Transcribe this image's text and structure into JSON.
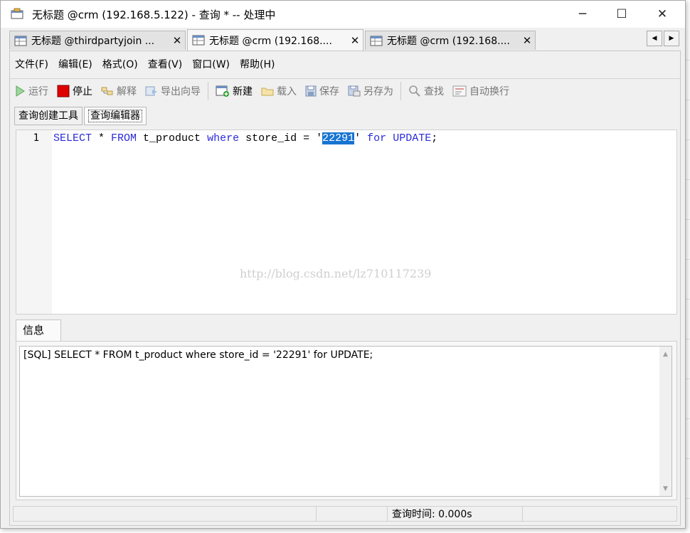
{
  "window": {
    "title": "无标题 @crm (192.168.5.122) - 查询 * -- 处理中",
    "minimize_glyph": "─",
    "maximize_glyph": "☐",
    "close_glyph": "✕"
  },
  "tabs": [
    {
      "label": "无标题 @thirdpartyjoin ...",
      "close": "✕"
    },
    {
      "label": "无标题 @crm (192.168....",
      "close": "✕"
    },
    {
      "label": "无标题 @crm (192.168....",
      "close": "✕"
    }
  ],
  "tab_nav": {
    "left": "◀",
    "right": "▶"
  },
  "menu": [
    "文件(F)",
    "编辑(E)",
    "格式(O)",
    "查看(V)",
    "窗口(W)",
    "帮助(H)"
  ],
  "toolbar": {
    "run": "运行",
    "stop": "停止",
    "explain": "解释",
    "export_wizard": "导出向导",
    "new": "新建",
    "load": "载入",
    "save": "保存",
    "save_as": "另存为",
    "find": "查找",
    "word_wrap": "自动换行"
  },
  "subtabs": {
    "builder": "查询创建工具",
    "editor": "查询编辑器"
  },
  "editor": {
    "line_number": "1",
    "tokens": {
      "select": "SELECT",
      "star": " * ",
      "from": "FROM",
      "table_part": " t_product ",
      "where": "where",
      "cond_part": " store_id = '",
      "selected_value": "22291",
      "quote_end": "' ",
      "for": "for",
      "space": " ",
      "update": "UPDATE",
      "semicolon": ";"
    }
  },
  "watermark": "http://blog.csdn.net/lz710117239",
  "info": {
    "tab_label": "信息",
    "message": "[SQL] SELECT * FROM t_product where store_id = '22291' for UPDATE;",
    "scroll_up": "▲",
    "scroll_down": "▼"
  },
  "status": {
    "query_time": "查询时间: 0.000s"
  },
  "colors": {
    "keyword": "#2b2bd9",
    "selection": "#1874d1",
    "stop_red": "#e00000",
    "run_green": "#2aa12a"
  }
}
